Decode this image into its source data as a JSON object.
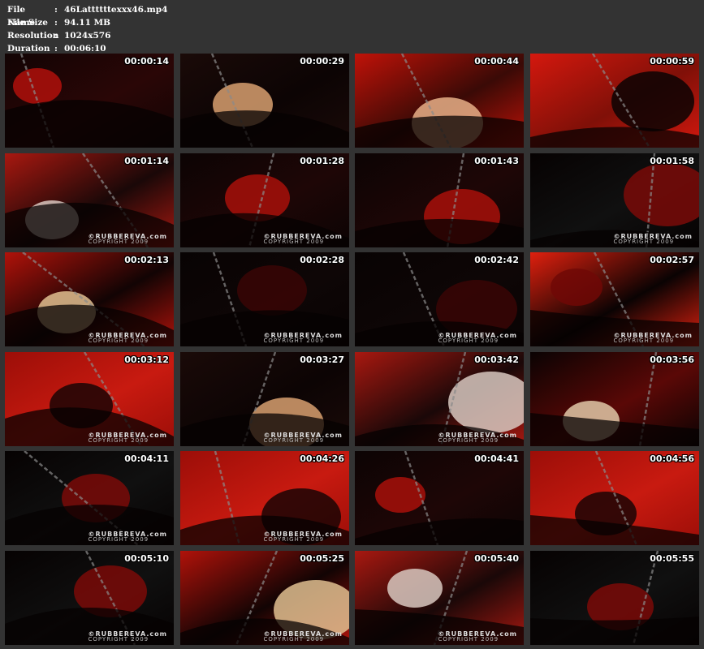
{
  "file_info": {
    "file_name_label": "File Name",
    "file_name": "46Lattttttexxx46.mp4",
    "file_size_label": "File Size",
    "file_size": "94.11 MB",
    "resolution_label": "Resolution",
    "resolution": "1024x576",
    "duration_label": "Duration",
    "duration": "00:06:10",
    "separator": ":"
  },
  "watermark": {
    "brand": "©RUBBEREVA.com",
    "copyright": "COPYRIGHT 2009"
  },
  "thumbnails": [
    {
      "time": "00:00:14",
      "tone": "red-dark",
      "watermark": false
    },
    {
      "time": "00:00:29",
      "tone": "blonde-dark",
      "watermark": false
    },
    {
      "time": "00:00:44",
      "tone": "face-red",
      "watermark": false
    },
    {
      "time": "00:00:59",
      "tone": "mask-red",
      "watermark": false
    },
    {
      "time": "00:01:14",
      "tone": "room-wide",
      "watermark": true
    },
    {
      "time": "00:01:28",
      "tone": "dark-red",
      "watermark": true
    },
    {
      "time": "00:01:43",
      "tone": "dark-red",
      "watermark": false
    },
    {
      "time": "00:01:58",
      "tone": "black-chain",
      "watermark": true
    },
    {
      "time": "00:02:13",
      "tone": "blonde-red",
      "watermark": true
    },
    {
      "time": "00:02:28",
      "tone": "black",
      "watermark": true
    },
    {
      "time": "00:02:42",
      "tone": "black",
      "watermark": true
    },
    {
      "time": "00:02:57",
      "tone": "red-bright",
      "watermark": true
    },
    {
      "time": "00:03:12",
      "tone": "red-chain",
      "watermark": true
    },
    {
      "time": "00:03:27",
      "tone": "blonde-dark",
      "watermark": true
    },
    {
      "time": "00:03:42",
      "tone": "room-wide",
      "watermark": true
    },
    {
      "time": "00:03:56",
      "tone": "blonde-black",
      "watermark": false
    },
    {
      "time": "00:04:11",
      "tone": "black-chain",
      "watermark": true
    },
    {
      "time": "00:04:26",
      "tone": "red-chain",
      "watermark": true
    },
    {
      "time": "00:04:41",
      "tone": "dark-red",
      "watermark": false
    },
    {
      "time": "00:04:56",
      "tone": "red-chain",
      "watermark": false
    },
    {
      "time": "00:05:10",
      "tone": "black-chain",
      "watermark": true
    },
    {
      "time": "00:05:25",
      "tone": "blonde-red",
      "watermark": true
    },
    {
      "time": "00:05:40",
      "tone": "room-wide",
      "watermark": true
    },
    {
      "time": "00:05:55",
      "tone": "black-chain",
      "watermark": false
    }
  ],
  "colors": {
    "page_bg": "#333333",
    "text": "#ffffff",
    "red": "#c4100c",
    "dark": "#0a0505"
  }
}
